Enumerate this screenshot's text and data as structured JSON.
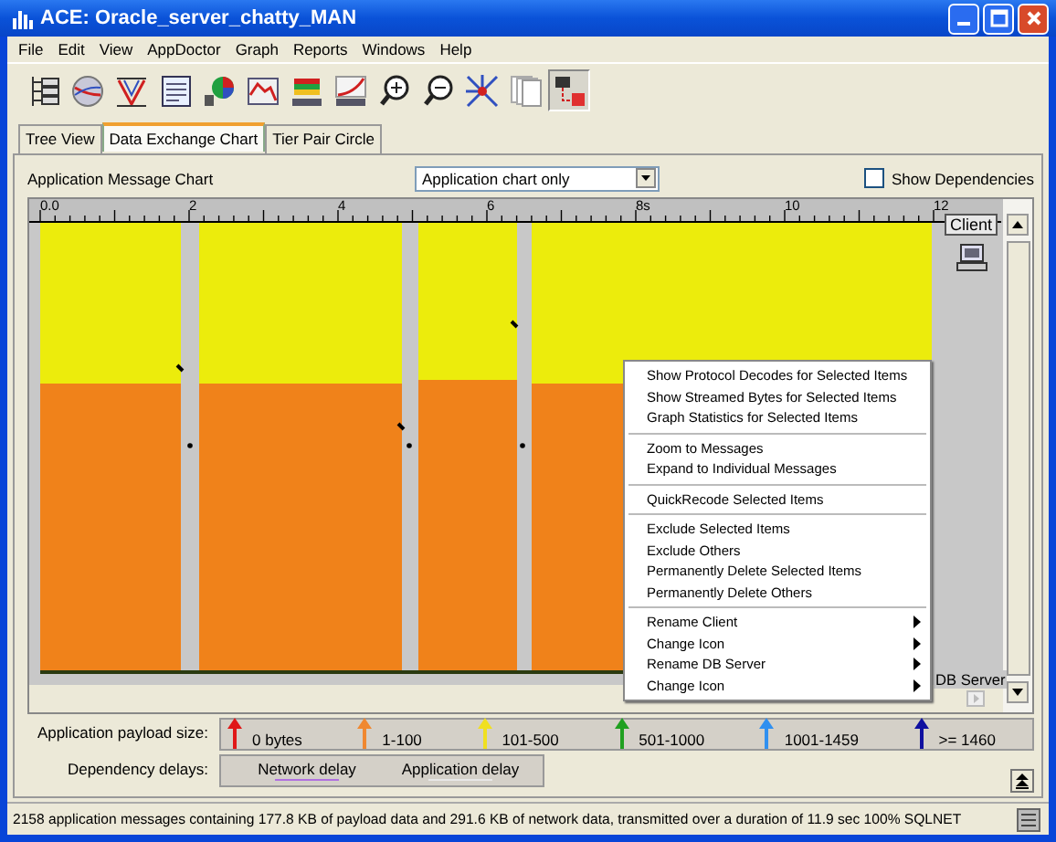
{
  "window": {
    "title": "ACE: Oracle_server_chatty_MAN"
  },
  "menu": [
    "File",
    "Edit",
    "View",
    "AppDoctor",
    "Graph",
    "Reports",
    "Windows",
    "Help"
  ],
  "toolbar": [
    {
      "kind": "tree",
      "pressed": false
    },
    {
      "kind": "globe",
      "pressed": false
    },
    {
      "kind": "filter",
      "pressed": false
    },
    {
      "kind": "report",
      "pressed": false
    },
    {
      "kind": "pie",
      "pressed": false
    },
    {
      "kind": "graph",
      "pressed": false
    },
    {
      "kind": "bars",
      "pressed": false
    },
    {
      "kind": "curve",
      "pressed": false
    },
    {
      "kind": "zoom-in",
      "pressed": false
    },
    {
      "kind": "zoom-out",
      "pressed": false
    },
    {
      "kind": "network",
      "pressed": false
    },
    {
      "kind": "pages",
      "pressed": false
    },
    {
      "kind": "selector",
      "pressed": true
    }
  ],
  "tabs": [
    {
      "label": "Tree View",
      "selected": false
    },
    {
      "label": "Data Exchange Chart",
      "selected": true
    },
    {
      "label": "Tier Pair Circle",
      "selected": false
    }
  ],
  "chart_panel": {
    "title": "Application Message Chart",
    "view_select": {
      "value": "Application chart only"
    },
    "show_dependencies": {
      "label": "Show Dependencies",
      "checked": false
    },
    "ruler": [
      "0.0",
      "2",
      "4",
      "6",
      "8s",
      "10",
      "12"
    ],
    "top_tier": "Client",
    "bottom_tier": "DB Server"
  },
  "context_menu": {
    "groups": [
      [
        {
          "label": "Show Protocol Decodes for Selected Items",
          "submenu": false
        },
        {
          "label": "Show Streamed Bytes for Selected Items",
          "submenu": false
        },
        {
          "label": "Graph Statistics for Selected Items",
          "submenu": false
        }
      ],
      [
        {
          "label": "Zoom to Messages",
          "submenu": false
        },
        {
          "label": "Expand to Individual Messages",
          "submenu": false
        }
      ],
      [
        {
          "label": "QuickRecode Selected Items",
          "submenu": false
        }
      ],
      [
        {
          "label": "Exclude Selected Items",
          "submenu": false
        },
        {
          "label": "Exclude Others",
          "submenu": false
        },
        {
          "label": "Permanently Delete Selected Items",
          "submenu": false
        },
        {
          "label": "Permanently Delete Others",
          "submenu": false
        }
      ],
      [
        {
          "label": "Rename Client",
          "submenu": true
        },
        {
          "label": "Change Icon",
          "submenu": true
        },
        {
          "label": "Rename DB Server",
          "submenu": true
        },
        {
          "label": "Change Icon",
          "submenu": true
        }
      ]
    ]
  },
  "legend": {
    "payload_label": "Application payload size:",
    "sizes": [
      {
        "label": "0 bytes",
        "color": "#e01818"
      },
      {
        "label": "1-100",
        "color": "#f08830"
      },
      {
        "label": "101-500",
        "color": "#f0e020"
      },
      {
        "label": "501-1000",
        "color": "#20a020"
      },
      {
        "label": "1001-1459",
        "color": "#3090f0"
      },
      {
        "label": ">= 1460",
        "color": "#1010a0"
      }
    ],
    "delays_label": "Dependency delays:",
    "delays": [
      {
        "label": "Network delay",
        "color": "#b070e0"
      },
      {
        "label": "Application delay",
        "color": "#e8e8e8"
      }
    ]
  },
  "status_bar": {
    "text": "2158 application messages containing 177.8 KB of payload data and 291.6 KB of network data, transmitted over a duration of 11.9 sec 100% SQLNET"
  }
}
